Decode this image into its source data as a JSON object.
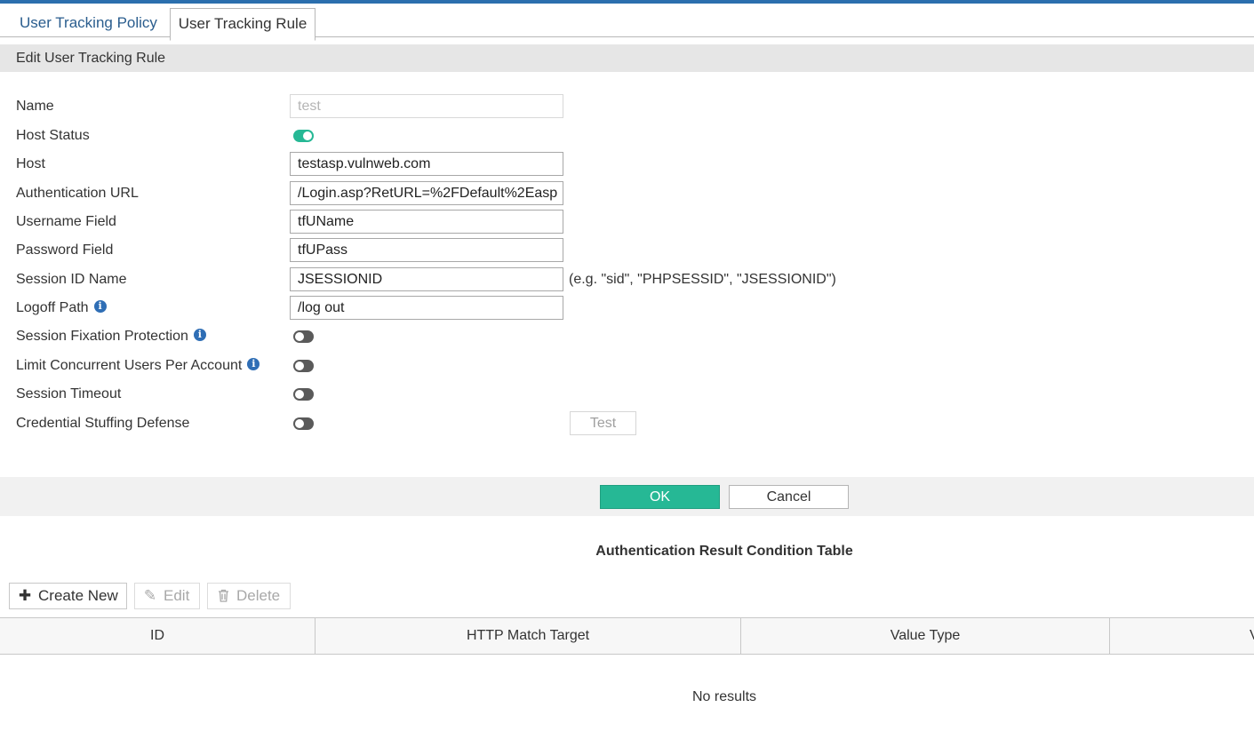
{
  "tabs": [
    {
      "label": "User Tracking Policy",
      "active": false
    },
    {
      "label": "User Tracking Rule",
      "active": true
    }
  ],
  "section_title": "Edit User Tracking Rule",
  "form": {
    "name": {
      "label": "Name",
      "value": "test",
      "disabled": true
    },
    "host_status": {
      "label": "Host Status",
      "enabled": true
    },
    "host": {
      "label": "Host",
      "value": "testasp.vulnweb.com"
    },
    "auth_url": {
      "label": "Authentication URL",
      "value": "/Login.asp?RetURL=%2FDefault%2Easp"
    },
    "username_field": {
      "label": "Username Field",
      "value": "tfUName"
    },
    "password_field": {
      "label": "Password Field",
      "value": "tfUPass"
    },
    "session_id_name": {
      "label": "Session ID Name",
      "value": "JSESSIONID",
      "hint": "(e.g. \"sid\", \"PHPSESSID\", \"JSESSIONID\")"
    },
    "logoff_path": {
      "label": "Logoff Path",
      "value": "/log out"
    },
    "session_fixation": {
      "label": "Session Fixation Protection",
      "enabled": false
    },
    "limit_concurrent": {
      "label": "Limit Concurrent Users Per Account",
      "enabled": false
    },
    "session_timeout": {
      "label": "Session Timeout",
      "enabled": false
    },
    "credential_stuffing": {
      "label": "Credential Stuffing Defense",
      "enabled": false,
      "test_label": "Test"
    }
  },
  "actions": {
    "ok": "OK",
    "cancel": "Cancel"
  },
  "table": {
    "title": "Authentication Result Condition Table",
    "toolbar": {
      "create": "Create New",
      "edit": "Edit",
      "delete": "Delete"
    },
    "columns": [
      "ID",
      "HTTP Match Target",
      "Value Type",
      "V"
    ],
    "empty_text": "No results"
  },
  "colors": {
    "accent": "#26b895",
    "brand_bar": "#2b6fae",
    "info_icon": "#2f6eb5"
  }
}
